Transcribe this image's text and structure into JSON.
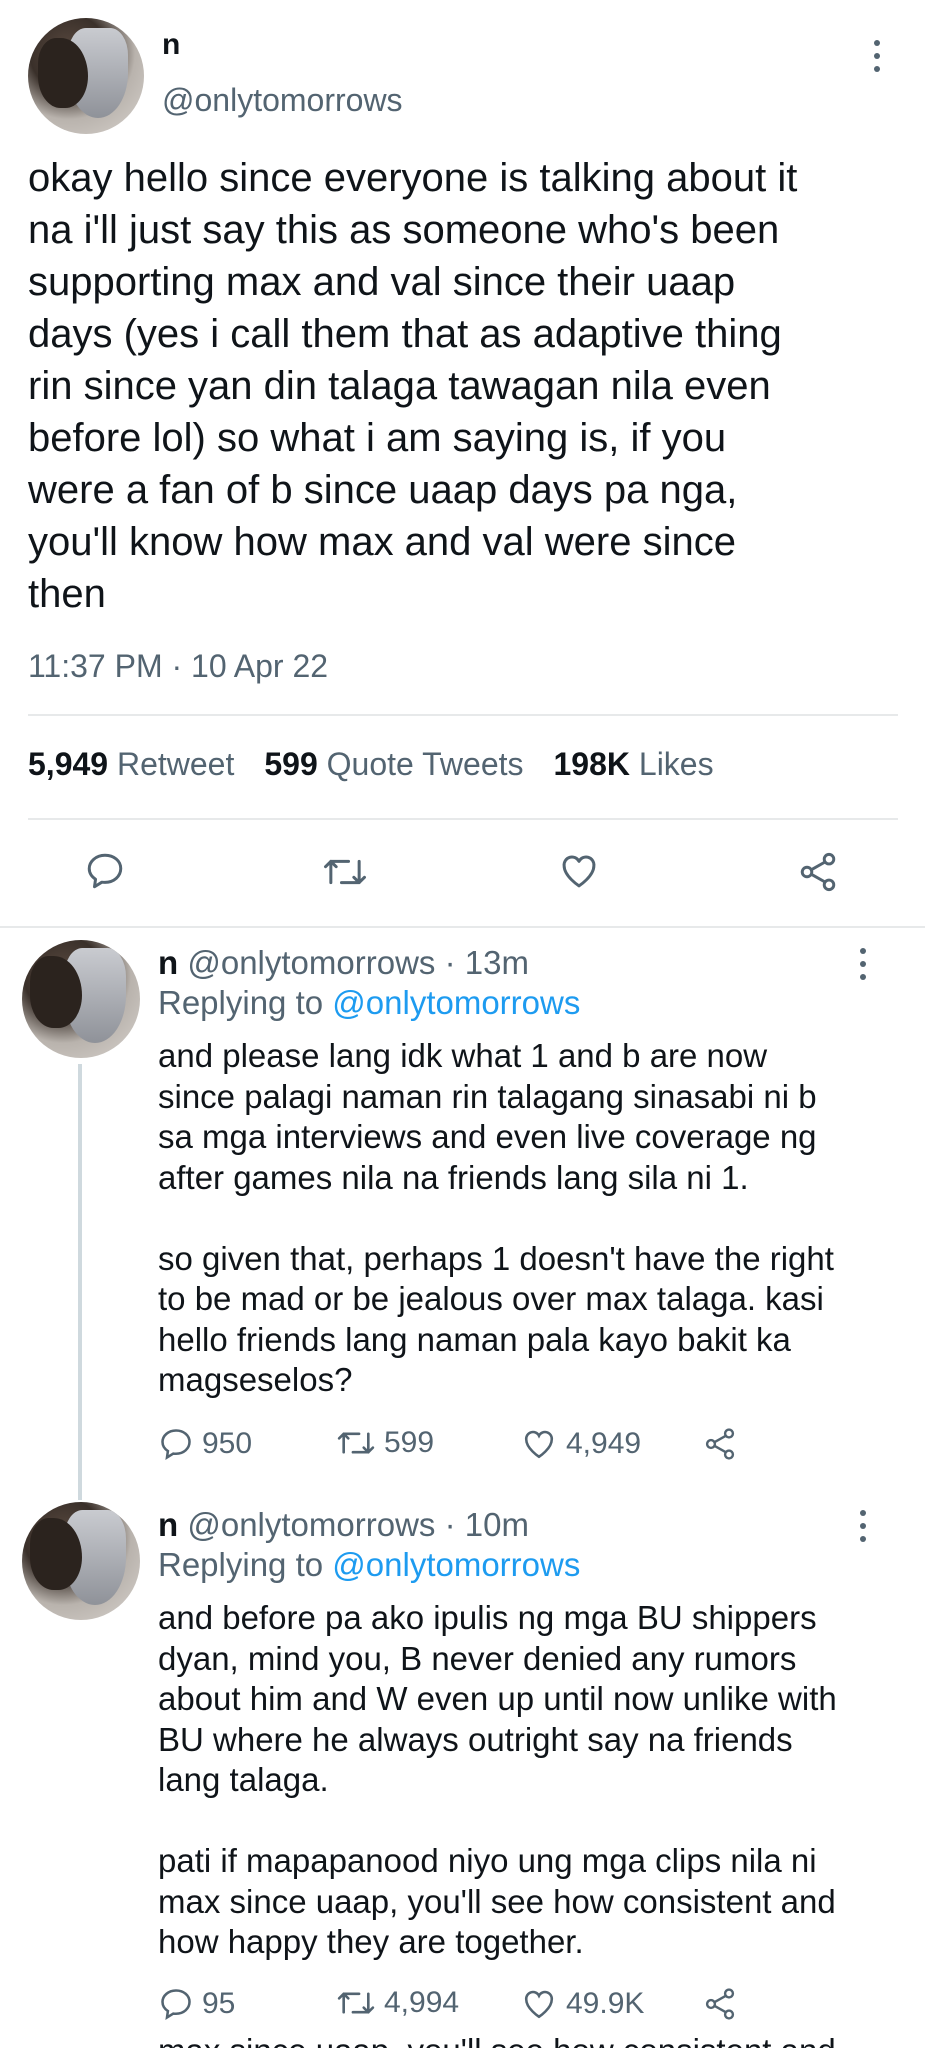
{
  "main_tweet": {
    "name": "n",
    "handle": "@onlytomorrows",
    "text": "okay hello since everyone is talking about it\nna i'll just say this as someone who's been\nsupporting max and val since their uaap\ndays (yes i call them that as adaptive thing\nrin since yan din talaga tawagan nila even\nbefore lol) so what i am saying is, if you\nwere a fan of b since uaap days pa nga,\nyou'll know how max and val were since\nthen",
    "timestamp": "11:37 PM · 10 Apr 22",
    "stats": {
      "retweets_count": "5,949",
      "retweets_label": "Retweet",
      "quotes_count": "599",
      "quotes_label": "Quote Tweets",
      "likes_count": "198K",
      "likes_label": "Likes"
    }
  },
  "replies": [
    {
      "name": "n",
      "handle_time": "@onlytomorrows · 13m",
      "replying_prefix": "Replying to",
      "replying_to": "@onlytomorrows",
      "text": "and please lang idk what 1 and b are now\nsince palagi naman rin talagang sinasabi ni b\nsa mga interviews and even live coverage ng\nafter games nila na friends lang sila ni 1.\n\nso given that, perhaps 1 doesn't have the right\nto be mad or be jealous over max talaga. kasi\nhello friends lang naman pala kayo bakit ka\nmagseselos?",
      "replies_count": "950",
      "retweets_count": "599",
      "likes_count": "4,949"
    },
    {
      "name": "n",
      "handle_time": "@onlytomorrows · 10m",
      "replying_prefix": "Replying to",
      "replying_to": "@onlytomorrows",
      "text": "and before pa ako ipulis ng mga BU shippers\ndyan, mind you, B never denied any rumors\nabout him and W even up until now unlike with\nBU where he always outright say na friends\nlang talaga.\n\npati if mapapanood niyo ung mga clips nila ni\nmax since uaap, you'll see how consistent and\nhow happy they are together.",
      "replies_count": "95",
      "retweets_count": "4,994",
      "likes_count": "49.9K"
    }
  ],
  "next_reply_peek": "max since uaap, you'll see how consistent and",
  "colors": {
    "text": "#0f1419",
    "secondary": "#536471",
    "link": "#1d9bf0",
    "divider": "#e7e9ea"
  },
  "icons": [
    "more-icon",
    "reply-icon",
    "retweet-icon",
    "like-icon",
    "share-icon"
  ]
}
